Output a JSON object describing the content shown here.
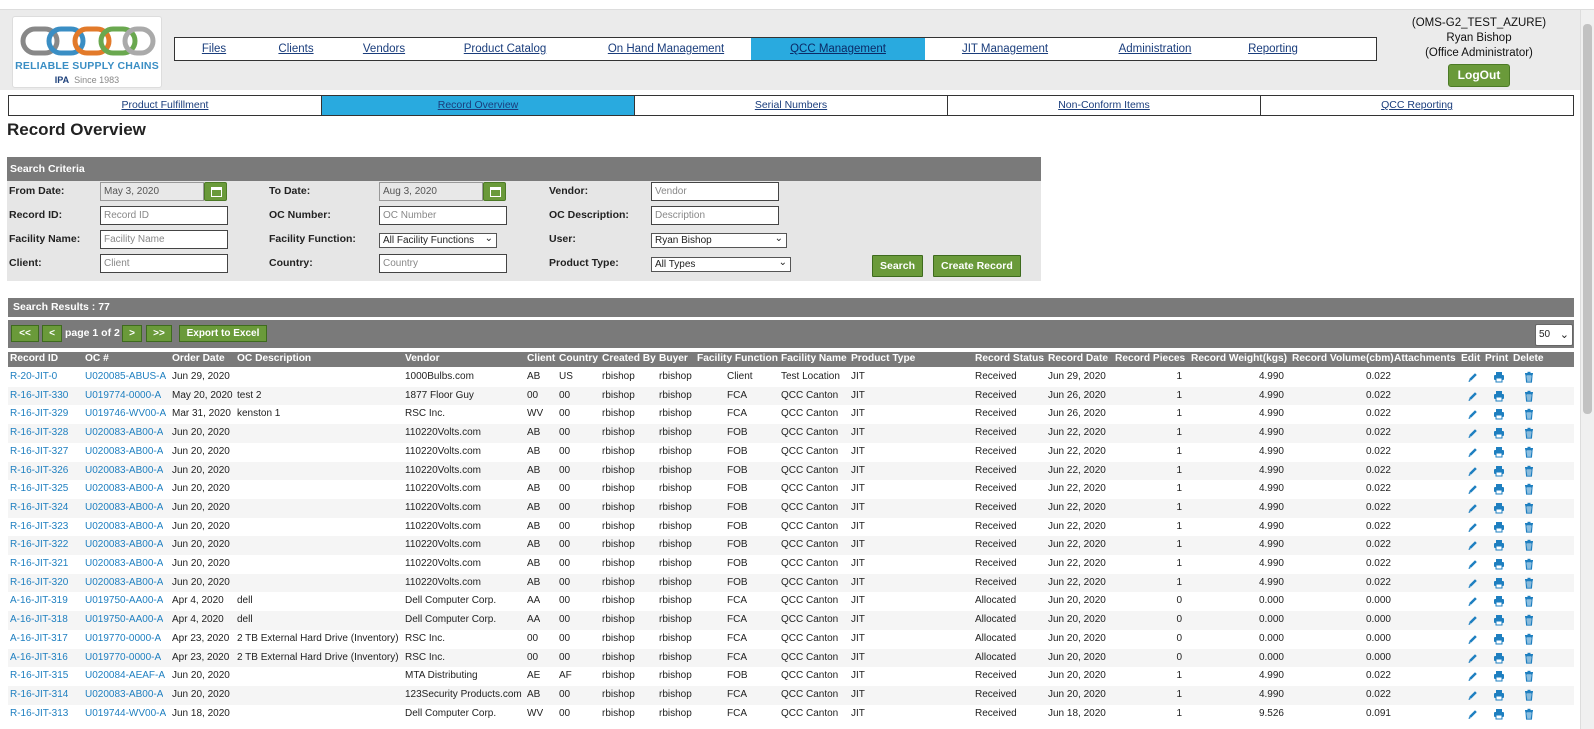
{
  "logo": {
    "name": "RELIABLE SUPPLY CHAINS",
    "ipa": "IPA",
    "since": "Since 1983"
  },
  "mainnav": [
    {
      "label": "Files",
      "active": false,
      "w": 78
    },
    {
      "label": "Clients",
      "active": false,
      "w": 86
    },
    {
      "label": "Vendors",
      "active": false,
      "w": 90
    },
    {
      "label": "Product Catalog",
      "active": false,
      "w": 152
    },
    {
      "label": "On Hand Management",
      "active": false,
      "w": 170
    },
    {
      "label": "QCC Management",
      "active": true,
      "w": 174
    },
    {
      "label": "JIT Management",
      "active": false,
      "w": 160
    },
    {
      "label": "Administration",
      "active": false,
      "w": 140
    },
    {
      "label": "Reporting",
      "active": false,
      "w": 96
    }
  ],
  "user": {
    "env": "(OMS-G2_TEST_AZURE)",
    "name": "Ryan Bishop",
    "role": "(Office Administrator)",
    "logout": "LogOut"
  },
  "subnav": [
    {
      "label": "Product Fulfillment",
      "active": false
    },
    {
      "label": "Record Overview",
      "active": true
    },
    {
      "label": "Serial Numbers",
      "active": false
    },
    {
      "label": "Non-Conform Items",
      "active": false
    },
    {
      "label": "QCC Reporting",
      "active": false
    }
  ],
  "page_title": "Record Overview",
  "search": {
    "title": "Search Criteria",
    "from_date_label": "From Date:",
    "from_date": "May 3, 2020",
    "to_date_label": "To Date:",
    "to_date": "Aug 3, 2020",
    "vendor_label": "Vendor:",
    "vendor_ph": "Vendor",
    "record_id_label": "Record ID:",
    "record_id_ph": "Record ID",
    "oc_number_label": "OC Number:",
    "oc_number_ph": "OC Number",
    "oc_desc_label": "OC Description:",
    "oc_desc_ph": "Description",
    "facility_name_label": "Facility Name:",
    "facility_name_ph": "Facility Name",
    "facility_function_label": "Facility Function:",
    "facility_function": "All Facility Functions",
    "user_label": "User:",
    "user": "Ryan Bishop",
    "client_label": "Client:",
    "client_ph": "Client",
    "country_label": "Country:",
    "country_ph": "Country",
    "product_type_label": "Product Type:",
    "product_type": "All Types",
    "search_btn": "Search",
    "create_btn": "Create Record"
  },
  "results": {
    "label": "Search Results : 77"
  },
  "pager": {
    "first": "<<",
    "prev": "<",
    "page": "page 1 of 2",
    "next": ">",
    "last": ">>",
    "export": "Export to Excel",
    "per_page": "50"
  },
  "table": {
    "columns": [
      "Record ID",
      "OC #",
      "Order Date",
      "OC Description",
      "Vendor",
      "Client",
      "Country",
      "Created By",
      "Buyer",
      "Facility Function",
      "Facility Name",
      "Product Type",
      "Record Status",
      "Record Date",
      "Record Pieces",
      "Record Weight(kgs)",
      "Record Volume(cbm)",
      "Attachments",
      "Edit",
      "Print",
      "Delete"
    ],
    "rows": [
      [
        "R-20-JIT-0",
        "U020085-ABUS-A",
        "Jun 29, 2020",
        "",
        "1000Bulbs.com",
        "AB",
        "US",
        "rbishop",
        "rbishop",
        "Client",
        "Test Location",
        "JIT",
        "Received",
        "Jun 29, 2020",
        "1",
        "4.990",
        "0.022"
      ],
      [
        "R-16-JIT-330",
        "U019774-0000-A",
        "May 20, 2020",
        "test 2",
        "1877 Floor Guy",
        "00",
        "00",
        "rbishop",
        "rbishop",
        "FCA",
        "QCC Canton",
        "JIT",
        "Received",
        "Jun 26, 2020",
        "1",
        "4.990",
        "0.022"
      ],
      [
        "R-16-JIT-329",
        "U019746-WV00-A",
        "Mar 31, 2020",
        "kenston 1",
        "RSC Inc.",
        "WV",
        "00",
        "rbishop",
        "rbishop",
        "FCA",
        "QCC Canton",
        "JIT",
        "Received",
        "Jun 26, 2020",
        "1",
        "4.990",
        "0.022"
      ],
      [
        "R-16-JIT-328",
        "U020083-AB00-A",
        "Jun 20, 2020",
        "",
        "110220Volts.com",
        "AB",
        "00",
        "rbishop",
        "rbishop",
        "FOB",
        "QCC Canton",
        "JIT",
        "Received",
        "Jun 22, 2020",
        "1",
        "4.990",
        "0.022"
      ],
      [
        "R-16-JIT-327",
        "U020083-AB00-A",
        "Jun 20, 2020",
        "",
        "110220Volts.com",
        "AB",
        "00",
        "rbishop",
        "rbishop",
        "FOB",
        "QCC Canton",
        "JIT",
        "Received",
        "Jun 22, 2020",
        "1",
        "4.990",
        "0.022"
      ],
      [
        "R-16-JIT-326",
        "U020083-AB00-A",
        "Jun 20, 2020",
        "",
        "110220Volts.com",
        "AB",
        "00",
        "rbishop",
        "rbishop",
        "FOB",
        "QCC Canton",
        "JIT",
        "Received",
        "Jun 22, 2020",
        "1",
        "4.990",
        "0.022"
      ],
      [
        "R-16-JIT-325",
        "U020083-AB00-A",
        "Jun 20, 2020",
        "",
        "110220Volts.com",
        "AB",
        "00",
        "rbishop",
        "rbishop",
        "FOB",
        "QCC Canton",
        "JIT",
        "Received",
        "Jun 22, 2020",
        "1",
        "4.990",
        "0.022"
      ],
      [
        "R-16-JIT-324",
        "U020083-AB00-A",
        "Jun 20, 2020",
        "",
        "110220Volts.com",
        "AB",
        "00",
        "rbishop",
        "rbishop",
        "FOB",
        "QCC Canton",
        "JIT",
        "Received",
        "Jun 22, 2020",
        "1",
        "4.990",
        "0.022"
      ],
      [
        "R-16-JIT-323",
        "U020083-AB00-A",
        "Jun 20, 2020",
        "",
        "110220Volts.com",
        "AB",
        "00",
        "rbishop",
        "rbishop",
        "FOB",
        "QCC Canton",
        "JIT",
        "Received",
        "Jun 22, 2020",
        "1",
        "4.990",
        "0.022"
      ],
      [
        "R-16-JIT-322",
        "U020083-AB00-A",
        "Jun 20, 2020",
        "",
        "110220Volts.com",
        "AB",
        "00",
        "rbishop",
        "rbishop",
        "FOB",
        "QCC Canton",
        "JIT",
        "Received",
        "Jun 22, 2020",
        "1",
        "4.990",
        "0.022"
      ],
      [
        "R-16-JIT-321",
        "U020083-AB00-A",
        "Jun 20, 2020",
        "",
        "110220Volts.com",
        "AB",
        "00",
        "rbishop",
        "rbishop",
        "FOB",
        "QCC Canton",
        "JIT",
        "Received",
        "Jun 22, 2020",
        "1",
        "4.990",
        "0.022"
      ],
      [
        "R-16-JIT-320",
        "U020083-AB00-A",
        "Jun 20, 2020",
        "",
        "110220Volts.com",
        "AB",
        "00",
        "rbishop",
        "rbishop",
        "FOB",
        "QCC Canton",
        "JIT",
        "Received",
        "Jun 22, 2020",
        "1",
        "4.990",
        "0.022"
      ],
      [
        "A-16-JIT-319",
        "U019750-AA00-A",
        "Apr 4, 2020",
        "dell",
        "Dell Computer Corp.",
        "AA",
        "00",
        "rbishop",
        "rbishop",
        "FCA",
        "QCC Canton",
        "JIT",
        "Allocated",
        "Jun 20, 2020",
        "0",
        "0.000",
        "0.000"
      ],
      [
        "A-16-JIT-318",
        "U019750-AA00-A",
        "Apr 4, 2020",
        "dell",
        "Dell Computer Corp.",
        "AA",
        "00",
        "rbishop",
        "rbishop",
        "FCA",
        "QCC Canton",
        "JIT",
        "Allocated",
        "Jun 20, 2020",
        "0",
        "0.000",
        "0.000"
      ],
      [
        "A-16-JIT-317",
        "U019770-0000-A",
        "Apr 23, 2020",
        "2 TB External Hard Drive (Inventory)",
        "RSC Inc.",
        "00",
        "00",
        "rbishop",
        "rbishop",
        "FCA",
        "QCC Canton",
        "JIT",
        "Allocated",
        "Jun 20, 2020",
        "0",
        "0.000",
        "0.000"
      ],
      [
        "A-16-JIT-316",
        "U019770-0000-A",
        "Apr 23, 2020",
        "2 TB External Hard Drive (Inventory)",
        "RSC Inc.",
        "00",
        "00",
        "rbishop",
        "rbishop",
        "FCA",
        "QCC Canton",
        "JIT",
        "Allocated",
        "Jun 20, 2020",
        "0",
        "0.000",
        "0.000"
      ],
      [
        "R-16-JIT-315",
        "U020084-AEAF-A",
        "Jun 20, 2020",
        "",
        "MTA Distributing",
        "AE",
        "AF",
        "rbishop",
        "rbishop",
        "FOB",
        "QCC Canton",
        "JIT",
        "Received",
        "Jun 20, 2020",
        "1",
        "4.990",
        "0.022"
      ],
      [
        "R-16-JIT-314",
        "U020083-AB00-A",
        "Jun 20, 2020",
        "",
        "123Security Products.com",
        "AB",
        "00",
        "rbishop",
        "rbishop",
        "FCA",
        "QCC Canton",
        "JIT",
        "Received",
        "Jun 20, 2020",
        "1",
        "4.990",
        "0.022"
      ],
      [
        "R-16-JIT-313",
        "U019744-WV00-A",
        "Jun 18, 2020",
        "",
        "Dell Computer Corp.",
        "WV",
        "00",
        "rbishop",
        "rbishop",
        "FCA",
        "QCC Canton",
        "JIT",
        "Received",
        "Jun 18, 2020",
        "1",
        "9.526",
        "0.091"
      ]
    ]
  },
  "icons": {
    "edit": "pencil-icon",
    "print": "printer-icon",
    "delete": "trash-icon",
    "calendar": "calendar-icon"
  },
  "colors": {
    "accent": "#29aadf",
    "button": "#6a9a3a",
    "link": "#1e7fc0",
    "bar": "#7a7a7a"
  }
}
